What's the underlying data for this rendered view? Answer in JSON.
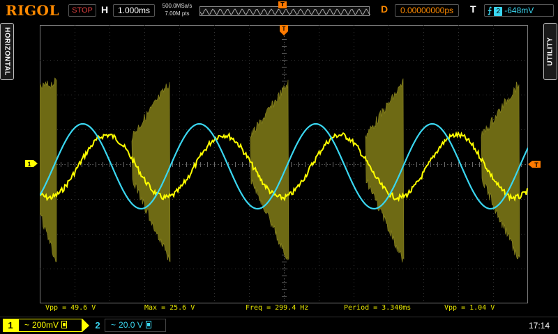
{
  "brand": "RIGOL",
  "run_status": "STOP",
  "horizontal": {
    "label": "H",
    "timebase": "1.000ms",
    "sample_rate": "500.0MSa/s",
    "memory_depth": "7.00M pts"
  },
  "trigger_marker_top": "T",
  "delay": {
    "label": "D",
    "value": "0.00000000ps"
  },
  "trigger": {
    "label": "T",
    "edge_icon": "rising-edge-icon",
    "edge_glyph": "⨍",
    "source": "2",
    "level": "-648mV"
  },
  "side_tabs": {
    "left": "HORIZONTAL",
    "right": "UTILITY"
  },
  "markers": {
    "ch1_level": "1",
    "trigger_level": "T"
  },
  "measurements": [
    {
      "text": "Vpp = 49.6 V"
    },
    {
      "text": "Max = 25.6 V"
    },
    {
      "text": "Freq = 299.4 Hz"
    },
    {
      "text": "Period = 3.340ms"
    },
    {
      "text": "Vpp = 1.04 V"
    }
  ],
  "channels": [
    {
      "number": "1",
      "coupling": "~",
      "scale": "200mV",
      "color": "#ffff00"
    },
    {
      "number": "2",
      "coupling": "~",
      "scale": "20.0 V",
      "color": "#3ad6f0"
    }
  ],
  "clock": "17:14",
  "colors": {
    "ch1": "#ffff00",
    "ch2": "#3ad6f0",
    "accent": "#ff8a00",
    "grid": "#3a3a3a"
  }
}
